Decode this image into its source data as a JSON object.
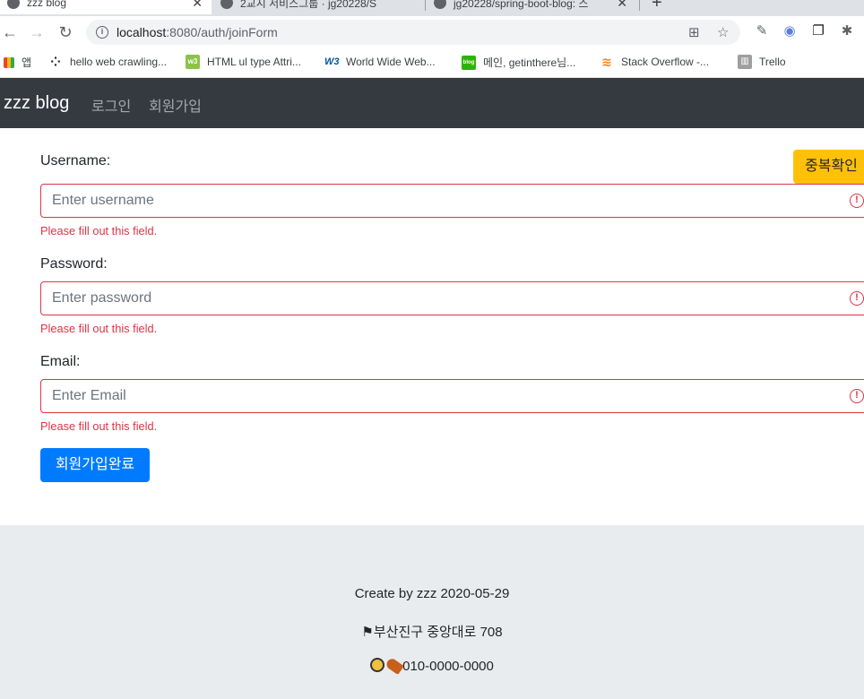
{
  "browser": {
    "tabs": [
      {
        "title": "zzz blog",
        "active": true
      },
      {
        "title": "2교시 서비스그룹 · jg20228/S",
        "active": false
      },
      {
        "title": "jg20228/spring-boot-blog: 스",
        "active": false
      }
    ],
    "url_host": "localhost",
    "url_path": ":8080/auth/joinForm",
    "bookmarks": [
      {
        "label": "앱",
        "icon": "apps-grid-icon"
      },
      {
        "label": "hello web crawling...",
        "icon": "dots-icon"
      },
      {
        "label": "HTML ul type Attri...",
        "icon": "w3-green-icon"
      },
      {
        "label": "World Wide Web...",
        "icon": "w3c-icon"
      },
      {
        "label": "메인, getinthere님...",
        "icon": "blog-icon"
      },
      {
        "label": "Stack Overflow -...",
        "icon": "stackoverflow-icon"
      },
      {
        "label": "Trello",
        "icon": "trello-icon"
      }
    ]
  },
  "navbar": {
    "brand": "zzz blog",
    "links": [
      "로그인",
      "회원가입"
    ]
  },
  "form": {
    "username_label": "Username:",
    "username_placeholder": "Enter username",
    "dup_check_label": "중복확인",
    "password_label": "Password:",
    "password_placeholder": "Enter password",
    "email_label": "Email:",
    "email_placeholder": "Enter Email",
    "invalid_feedback": "Please fill out this field.",
    "submit_label": "회원가입완료"
  },
  "footer": {
    "created": "Create by zzz 2020-05-29",
    "address": "부산진구 중앙대로 708",
    "phone": "010-0000-0000"
  },
  "colors": {
    "navbar": "#343a40",
    "danger": "#dc3545",
    "warning": "#ffc107",
    "primary": "#007bff",
    "footer": "#e9ecef"
  }
}
